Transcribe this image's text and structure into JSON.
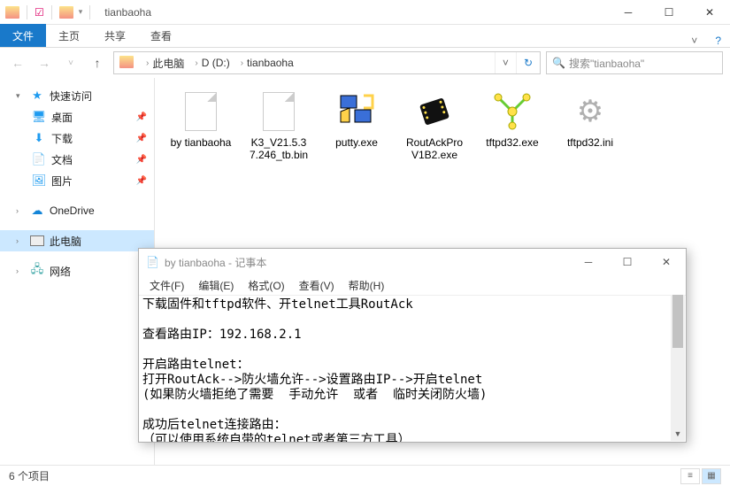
{
  "window": {
    "title": "tianbaoha"
  },
  "ribbon": {
    "file": "文件",
    "tabs": [
      "主页",
      "共享",
      "查看"
    ]
  },
  "nav": {
    "crumbs": [
      "此电脑",
      "D (D:)",
      "tianbaoha"
    ],
    "search_placeholder": "搜索\"tianbaoha\""
  },
  "sidebar": {
    "quick": "快速访问",
    "desktop": "桌面",
    "downloads": "下载",
    "documents": "文档",
    "pictures": "图片",
    "onedrive": "OneDrive",
    "thispc": "此电脑",
    "network": "网络"
  },
  "files": [
    {
      "name": "by tianbaoha",
      "type": "doc"
    },
    {
      "name": "K3_V21.5.37.246_tb.bin",
      "type": "doc"
    },
    {
      "name": "putty.exe",
      "type": "putty"
    },
    {
      "name": "RoutAckProV1B2.exe",
      "type": "chip"
    },
    {
      "name": "tftpd32.exe",
      "type": "tftp"
    },
    {
      "name": "tftpd32.ini",
      "type": "gear"
    }
  ],
  "status": {
    "count": "6 个项目"
  },
  "notepad": {
    "title": "by tianbaoha - 记事本",
    "menu": [
      "文件(F)",
      "编辑(E)",
      "格式(O)",
      "查看(V)",
      "帮助(H)"
    ],
    "text": "下载固件和tftpd软件、开telnet工具RoutAck\n\n查看路由IP：192.168.2.1\n\n开启路由telnet：\n打开RoutAck-->防火墙允许-->设置路由IP-->开启telnet\n(如果防火墙拒绝了需要  手动允许  或者  临时关闭防火墙)\n\n成功后telnet连接路由：\n（可以使用系统自带的telnet或者第三方工具）"
  }
}
